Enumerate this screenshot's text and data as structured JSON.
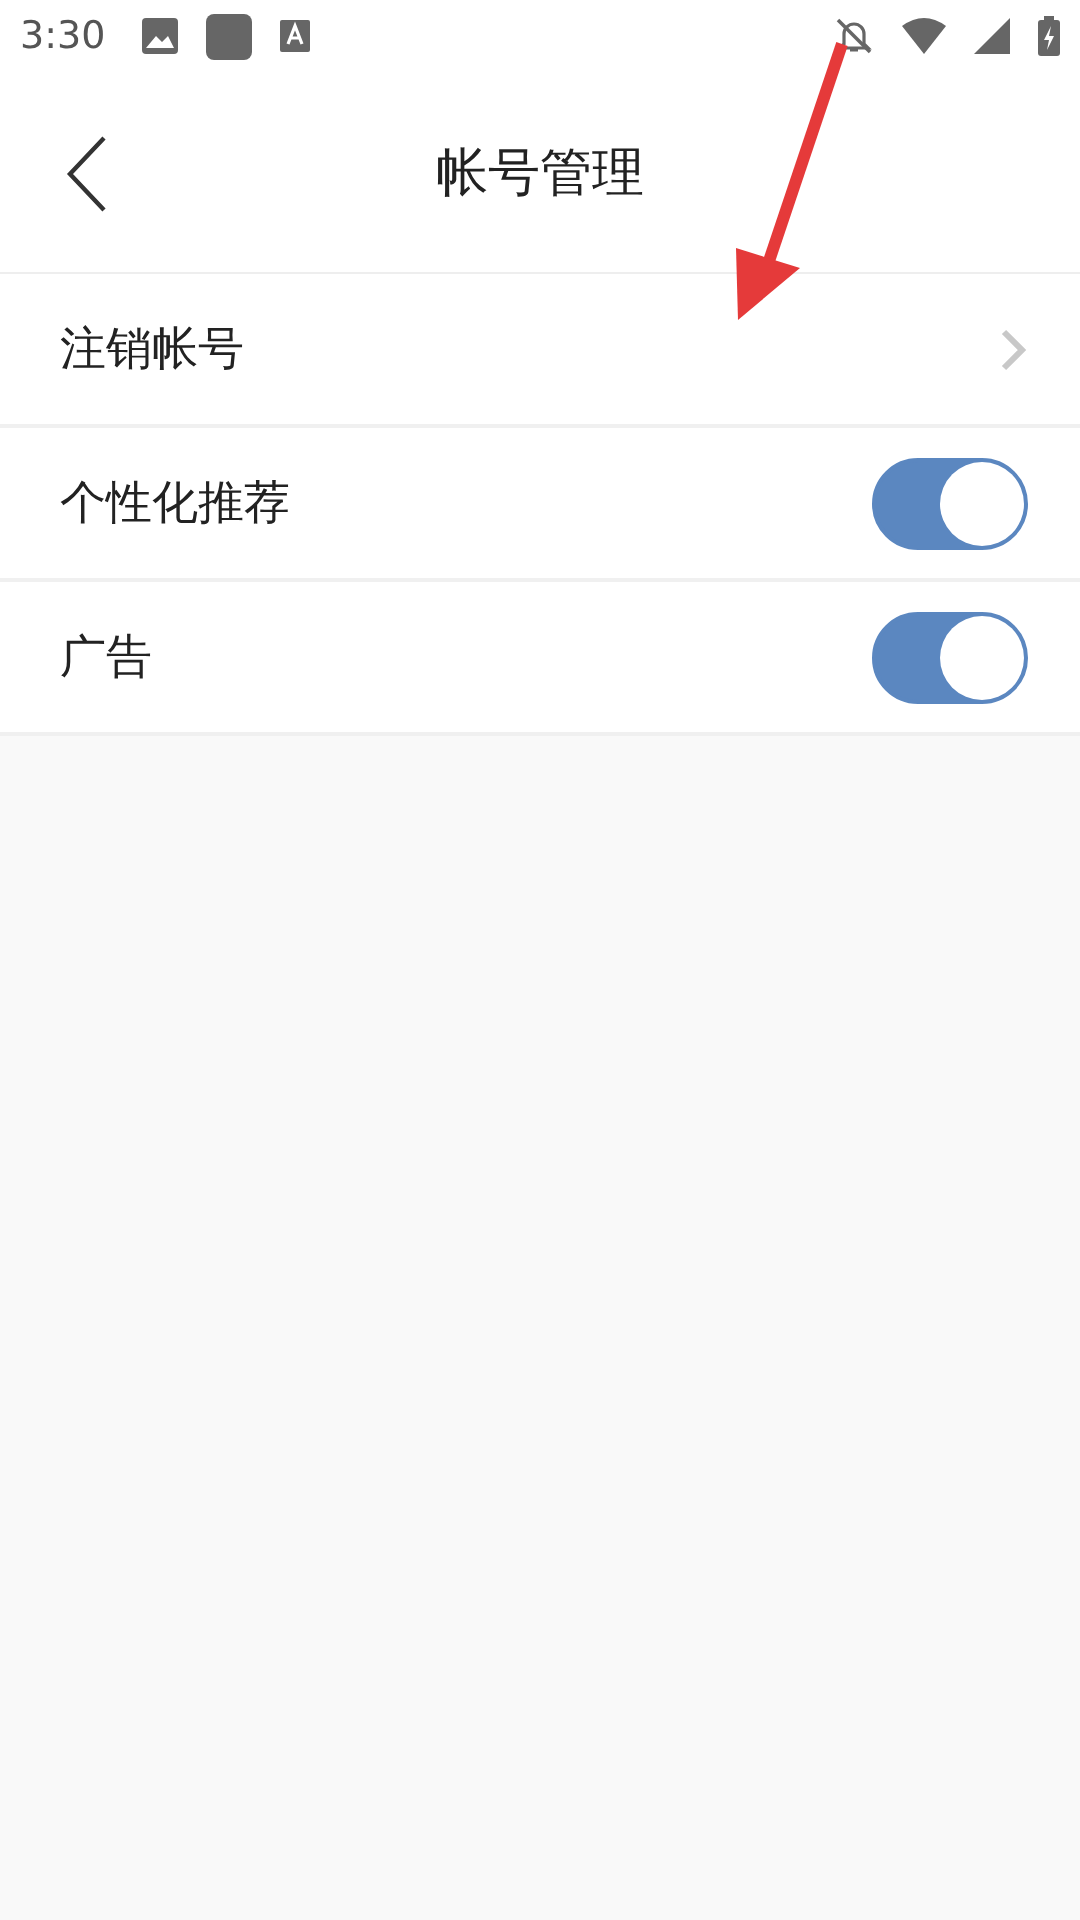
{
  "status_bar": {
    "time": "3:30"
  },
  "header": {
    "title": "帐号管理"
  },
  "rows": [
    {
      "kind": "link",
      "label": "注销帐号"
    },
    {
      "kind": "toggle",
      "label": "个性化推荐",
      "on": true
    },
    {
      "kind": "toggle",
      "label": "广告",
      "on": true
    }
  ]
}
